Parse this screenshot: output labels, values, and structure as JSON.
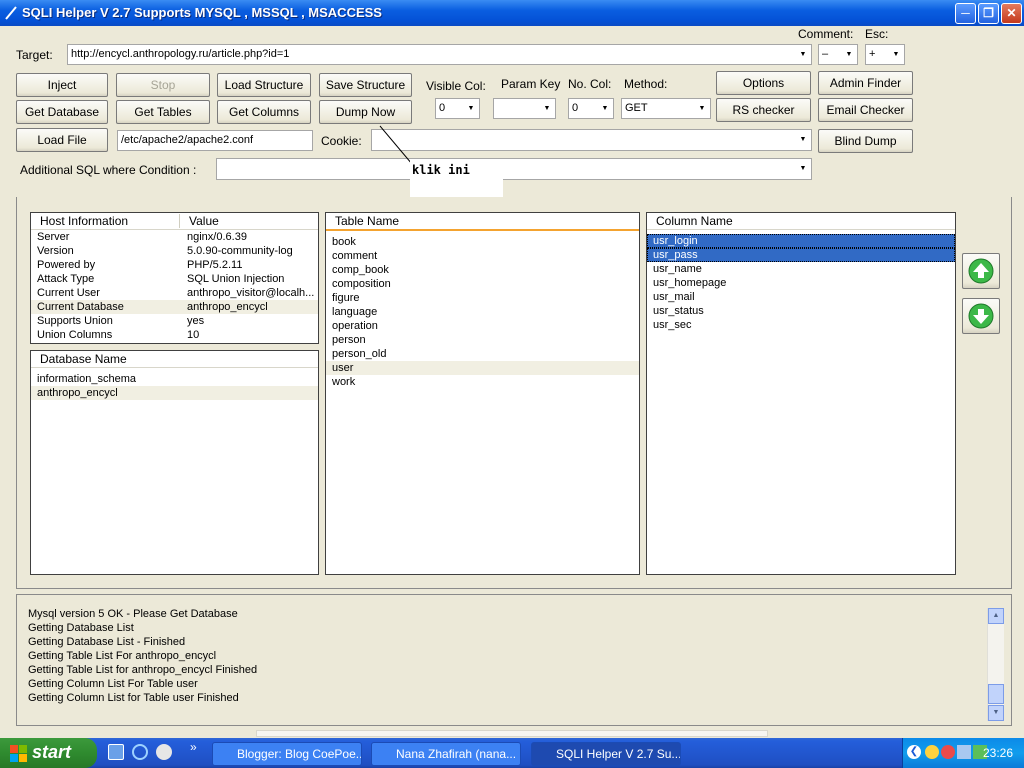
{
  "window": {
    "title": "SQLI Helper V 2.7 Supports MYSQL , MSSQL , MSACCESS"
  },
  "target": {
    "label": "Target:",
    "value": "http://encycl.anthropology.ru/article.php?id=1"
  },
  "comment": {
    "label": "Comment:",
    "value": "–"
  },
  "esc": {
    "label": "Esc:",
    "value": "+"
  },
  "buttons": {
    "inject": "Inject",
    "stop": "Stop",
    "load_structure": "Load Structure",
    "save_structure": "Save Structure",
    "get_database": "Get Database",
    "get_tables": "Get Tables",
    "get_columns": "Get Columns",
    "dump_now": "Dump Now",
    "load_file": "Load File",
    "options": "Options",
    "admin_finder": "Admin Finder",
    "rs_checker": "RS checker",
    "email_checker": "Email Checker",
    "blind_dump": "Blind Dump"
  },
  "visible_col": {
    "label": "Visible Col:",
    "value": "0"
  },
  "param_key": {
    "label": "Param Key",
    "value": ""
  },
  "no_col": {
    "label": "No. Col:",
    "value": "0"
  },
  "method": {
    "label": "Method:",
    "value": "GET"
  },
  "load_file_path": "/etc/apache2/apache2.conf",
  "cookie": {
    "label": "Cookie:",
    "value": ""
  },
  "additional_sql": {
    "label": "Additional SQL where Condition :",
    "value": ""
  },
  "annotation": "klik ini",
  "host_info": {
    "col1": "Host Information",
    "col2": "Value",
    "rows": [
      {
        "key": "Server",
        "value": "nginx/0.6.39"
      },
      {
        "key": "Version",
        "value": "5.0.90-community-log"
      },
      {
        "key": "Powered by",
        "value": "PHP/5.2.11"
      },
      {
        "key": "Attack Type",
        "value": "SQL Union Injection"
      },
      {
        "key": "Current User",
        "value": "anthropo_visitor@localh..."
      },
      {
        "key": "Current Database",
        "value": "anthropo_encycl"
      },
      {
        "key": "Supports Union",
        "value": "yes"
      },
      {
        "key": "Union Columns",
        "value": "10"
      }
    ]
  },
  "databases": {
    "header": "Database Name",
    "rows": [
      "information_schema",
      "anthropo_encycl"
    ]
  },
  "tables": {
    "header": "Table Name",
    "rows": [
      "book",
      "comment",
      "comp_book",
      "composition",
      "figure",
      "language",
      "operation",
      "person",
      "person_old",
      "user",
      "work"
    ]
  },
  "columns": {
    "header": "Column Name",
    "rows": [
      "usr_login",
      "usr_pass",
      "usr_name",
      "usr_homepage",
      "usr_mail",
      "usr_status",
      "usr_sec"
    ]
  },
  "log": [
    "Mysql version 5 OK - Please Get Database",
    "Getting Database List",
    "Getting Database List - Finished",
    "Getting Table List For anthropo_encycl",
    "Getting Table List for anthropo_encycl Finished",
    "Getting Column List For Table user",
    "Getting Column List for Table user Finished"
  ],
  "taskbar": {
    "start": "start",
    "tasks": [
      "Blogger: Blog CoePoe...",
      "Nana Zhafirah (nana...",
      "SQLI Helper V 2.7 Su..."
    ],
    "clock": "23:26"
  },
  "colors": {
    "title_blue": "#0a5ee0",
    "selection": "#316ac5",
    "header_accent": "#f4a32f"
  }
}
